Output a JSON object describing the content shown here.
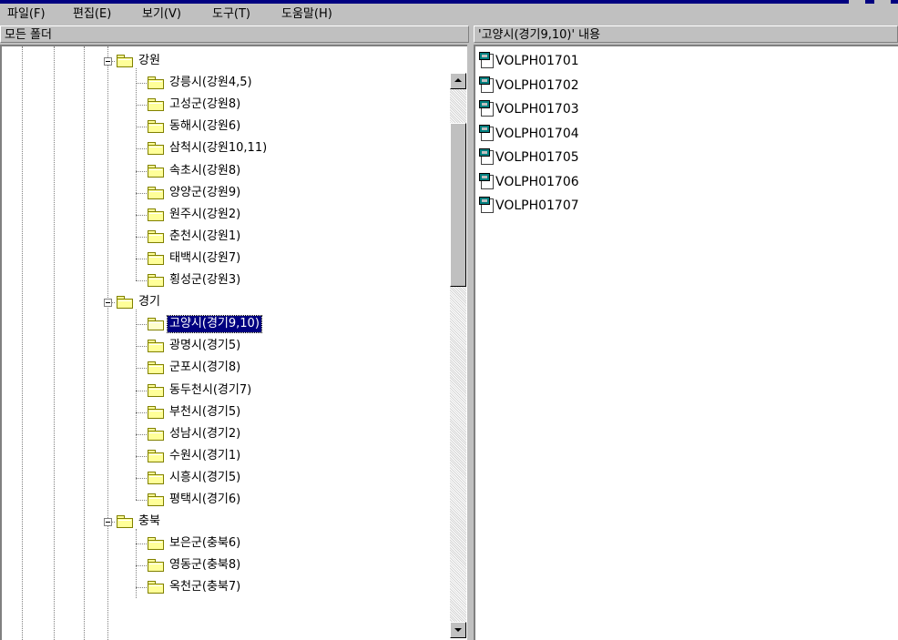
{
  "menu": [
    {
      "label": "파일(F)"
    },
    {
      "label": "편집(E)"
    },
    {
      "label": "보기(V)"
    },
    {
      "label": "도구(T)"
    },
    {
      "label": "도움말(H)"
    }
  ],
  "tree_header": "모든 폴더",
  "list_header": "'고양시(경기9,10)' 내용",
  "tree": [
    {
      "level": 1,
      "label": "강원",
      "expanded": true
    },
    {
      "level": 2,
      "label": "강릉시(강원4,5)"
    },
    {
      "level": 2,
      "label": "고성군(강원8)"
    },
    {
      "level": 2,
      "label": "동해시(강원6)"
    },
    {
      "level": 2,
      "label": "삼척시(강원10,11)"
    },
    {
      "level": 2,
      "label": "속초시(강원8)"
    },
    {
      "level": 2,
      "label": "양양군(강원9)"
    },
    {
      "level": 2,
      "label": "원주시(강원2)"
    },
    {
      "level": 2,
      "label": "춘천시(강원1)"
    },
    {
      "level": 2,
      "label": "태백시(강원7)"
    },
    {
      "level": 2,
      "label": "횡성군(강원3)"
    },
    {
      "level": 1,
      "label": "경기",
      "expanded": true
    },
    {
      "level": 2,
      "label": "고양시(경기9,10)",
      "selected": true
    },
    {
      "level": 2,
      "label": "광명시(경기5)"
    },
    {
      "level": 2,
      "label": "군포시(경기8)"
    },
    {
      "level": 2,
      "label": "동두천시(경기7)"
    },
    {
      "level": 2,
      "label": "부천시(경기5)"
    },
    {
      "level": 2,
      "label": "성남시(경기2)"
    },
    {
      "level": 2,
      "label": "수원시(경기1)"
    },
    {
      "level": 2,
      "label": "시흥시(경기5)"
    },
    {
      "level": 2,
      "label": "평택시(경기6)"
    },
    {
      "level": 1,
      "label": "충북",
      "expanded": true
    },
    {
      "level": 2,
      "label": "보은군(충북6)"
    },
    {
      "level": 2,
      "label": "영동군(충북8)"
    },
    {
      "level": 2,
      "label": "옥천군(충북7)"
    }
  ],
  "files": [
    {
      "label": "VOLPH01701"
    },
    {
      "label": "VOLPH01702"
    },
    {
      "label": "VOLPH01703"
    },
    {
      "label": "VOLPH01704"
    },
    {
      "label": "VOLPH01705"
    },
    {
      "label": "VOLPH01706"
    },
    {
      "label": "VOLPH01707"
    }
  ],
  "colors": {
    "selection": "#000080",
    "folder": "#ffff99",
    "file_icon": "#008080"
  }
}
